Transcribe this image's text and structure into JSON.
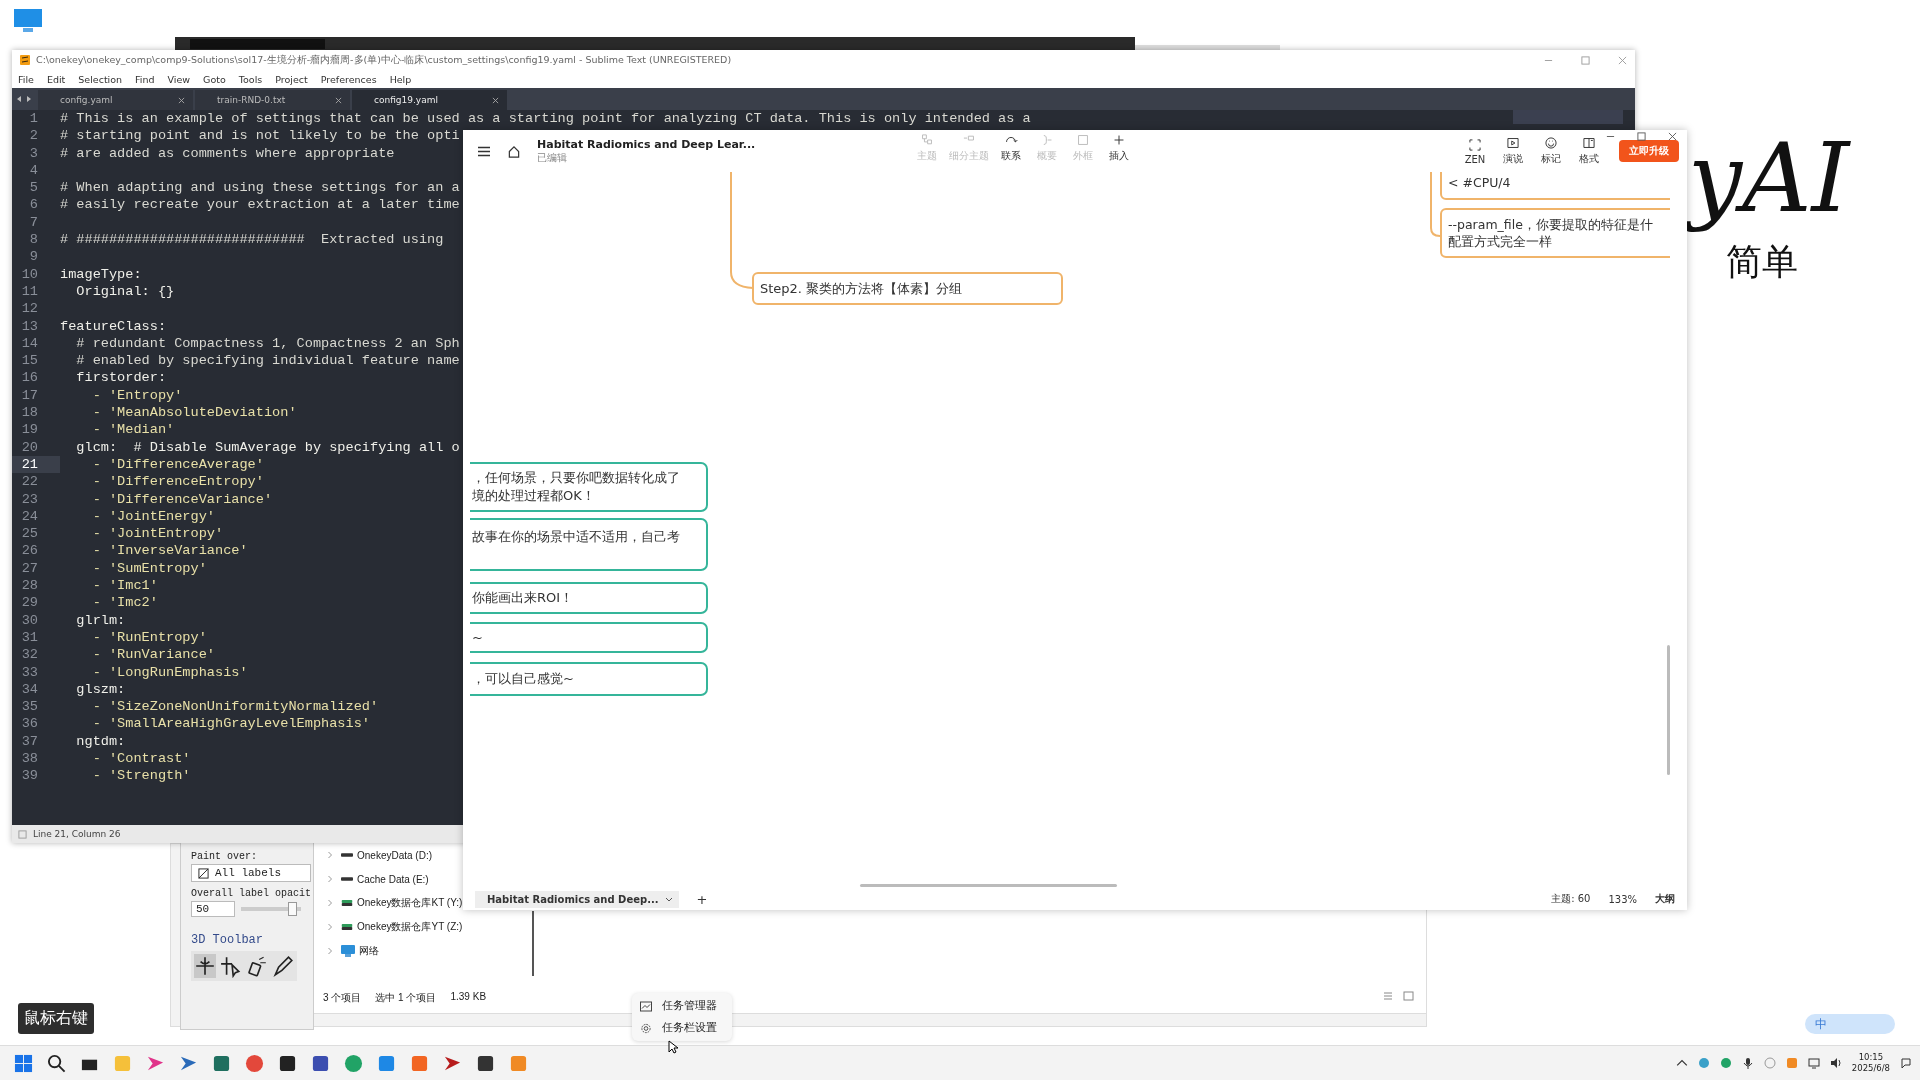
{
  "sublime": {
    "title": "C:\\onekey\\onekey_comp\\comp9-Solutions\\sol17-生境分析-瘤内瘤周-多(单)中心-临床\\custom_settings\\config19.yaml - Sublime Text (UNREGISTERED)",
    "menu": [
      "File",
      "Edit",
      "Selection",
      "Find",
      "View",
      "Goto",
      "Tools",
      "Project",
      "Preferences",
      "Help"
    ],
    "tabs": [
      {
        "label": "config.yaml",
        "selected": false
      },
      {
        "label": "train-RND-0.txt",
        "selected": false
      },
      {
        "label": "config19.yaml",
        "selected": true
      }
    ],
    "lines": [
      {
        "n": "1",
        "text": "# This is an example of settings that can be used as a starting point for analyzing CT data. This is only intended as a",
        "kind": "comment",
        "current": false
      },
      {
        "n": "2",
        "text": "# starting point and is not likely to be the opti",
        "kind": "comment",
        "current": false
      },
      {
        "n": "3",
        "text": "# are added as comments where appropriate",
        "kind": "comment",
        "current": false
      },
      {
        "n": "4",
        "current": false
      },
      {
        "n": "5",
        "text": "# When adapting and using these settings for an a",
        "kind": "comment",
        "current": false
      },
      {
        "n": "6",
        "text": "# easily recreate your extraction at a later time",
        "kind": "comment",
        "current": false
      },
      {
        "n": "7",
        "current": false
      },
      {
        "n": "8",
        "text": "# ############################  Extracted using",
        "kind": "comment",
        "current": false
      },
      {
        "n": "9",
        "current": false
      },
      {
        "n": "10",
        "text": "imageType:",
        "kind": "key",
        "current": false
      },
      {
        "n": "11",
        "text": "  Original: {}",
        "kind": "key",
        "current": false
      },
      {
        "n": "12",
        "current": false
      },
      {
        "n": "13",
        "text": "featureClass:",
        "kind": "key",
        "current": false
      },
      {
        "n": "14",
        "text": "  # redundant Compactness 1, Compactness 2 an Sph",
        "kind": "comment",
        "current": false
      },
      {
        "n": "15",
        "text": "  # enabled by specifying individual feature name",
        "kind": "comment",
        "current": false
      },
      {
        "n": "16",
        "text": "  firstorder:",
        "kind": "key",
        "current": false
      },
      {
        "n": "17",
        "text": "    - 'Entropy'",
        "kind": "item",
        "current": false
      },
      {
        "n": "18",
        "text": "    - 'MeanAbsoluteDeviation'",
        "kind": "item",
        "current": false
      },
      {
        "n": "19",
        "text": "    - 'Median'",
        "kind": "item",
        "current": false
      },
      {
        "n": "20",
        "text": "  glcm:  # Disable SumAverage by specifying all o",
        "kind": "key",
        "current": false
      },
      {
        "n": "21",
        "text": "    - 'DifferenceAverage'",
        "kind": "item",
        "current": true
      },
      {
        "n": "22",
        "text": "    - 'DifferenceEntropy'",
        "kind": "item",
        "current": false
      },
      {
        "n": "23",
        "text": "    - 'DifferenceVariance'",
        "kind": "item",
        "current": false
      },
      {
        "n": "24",
        "text": "    - 'JointEnergy'",
        "kind": "item",
        "current": false
      },
      {
        "n": "25",
        "text": "    - 'JointEntropy'",
        "kind": "item",
        "current": false
      },
      {
        "n": "26",
        "text": "    - 'InverseVariance'",
        "kind": "item",
        "current": false
      },
      {
        "n": "27",
        "text": "    - 'SumEntropy'",
        "kind": "item",
        "current": false
      },
      {
        "n": "28",
        "text": "    - 'Imc1'",
        "kind": "item",
        "current": false
      },
      {
        "n": "29",
        "text": "    - 'Imc2'",
        "kind": "item",
        "current": false
      },
      {
        "n": "30",
        "text": "  glrlm:",
        "kind": "key",
        "current": false
      },
      {
        "n": "31",
        "text": "    - 'RunEntropy'",
        "kind": "item",
        "current": false
      },
      {
        "n": "32",
        "text": "    - 'RunVariance'",
        "kind": "item",
        "current": false
      },
      {
        "n": "33",
        "text": "    - 'LongRunEmphasis'",
        "kind": "item",
        "current": false
      },
      {
        "n": "34",
        "text": "  glszm:",
        "kind": "key",
        "current": false
      },
      {
        "n": "35",
        "text": "    - 'SizeZoneNonUniformityNormalized'",
        "kind": "item",
        "current": false
      },
      {
        "n": "36",
        "text": "    - 'SmallAreaHighGrayLevelEmphasis'",
        "kind": "item",
        "current": false
      },
      {
        "n": "37",
        "text": "  ngtdm:",
        "kind": "key",
        "current": false
      },
      {
        "n": "38",
        "text": "    - 'Contrast'",
        "kind": "item",
        "current": false
      },
      {
        "n": "39",
        "text": "    - 'Strength'",
        "kind": "item",
        "current": false
      }
    ],
    "status": "Line 21, Column 26"
  },
  "mindmap": {
    "title": "Habitat Radiomics and Deep Lear...",
    "subtitle": "已编辑",
    "tools": [
      {
        "label": "主题",
        "disabled": true
      },
      {
        "label": "细分主题",
        "disabled": true
      },
      {
        "label": "联系",
        "disabled": false
      },
      {
        "label": "概要",
        "disabled": true
      },
      {
        "label": "外框",
        "disabled": true
      },
      {
        "label": "插入",
        "disabled": false
      }
    ],
    "right_tools": [
      "ZEN",
      "演说",
      "标记",
      "格式"
    ],
    "upgrade_button": "立即升级",
    "step_node": "Step2. 聚类的方法将【体素】分组",
    "right_nodes": [
      {
        "lines": [
          "< #CPU/4"
        ]
      },
      {
        "lines": [
          "--param_file，你要提取的特征是什",
          "配置方式完全一样"
        ]
      }
    ],
    "left_nodes": [
      {
        "lines": [
          "，任何场景，只要你吧数据转化成了",
          "境的处理过程都OK！"
        ]
      },
      {
        "lines": [
          "故事在你的场景中适不适用，自己考"
        ]
      },
      {
        "lines": [
          "你能画出来ROI！"
        ]
      },
      {
        "lines": [
          "~"
        ]
      },
      {
        "lines": [
          "，可以自己感觉~"
        ]
      }
    ],
    "sheet_tab": "Habitat Radiomics and Deep...",
    "add_sheet": "+",
    "topics": "主题: 60",
    "zoom": "133%",
    "outline": "大纲"
  },
  "backdrop": {
    "logo": "yAI",
    "slogan": "简单"
  },
  "slicer": {
    "paint_over_label": "Paint over:",
    "paint_over_value": "All labels",
    "opacity_label": "Overall label opacit",
    "opacity_value": "50",
    "opacity_slider": {
      "level": 0.85
    },
    "toolbar_title": "3D Toolbar"
  },
  "explorer": {
    "items": [
      {
        "label": "OnekeyData (D:)",
        "kind": "drive"
      },
      {
        "label": "Cache Data (E:)",
        "kind": "drive"
      },
      {
        "label": "Onekey数据仓库KT (Y:)",
        "kind": "netdrive"
      },
      {
        "label": "Onekey数据仓库YT (Z:)",
        "kind": "netdrive"
      },
      {
        "label": "网络",
        "kind": "network"
      }
    ],
    "count": "3 个项目",
    "selection": "选中 1 个项目",
    "size": "1.39 KB"
  },
  "context_menu": [
    "任务管理器",
    "任务栏设置"
  ],
  "caption": "鼠标右键",
  "ime": "中",
  "taskbar": {
    "time": "10:15",
    "date": "2025/6/8"
  }
}
